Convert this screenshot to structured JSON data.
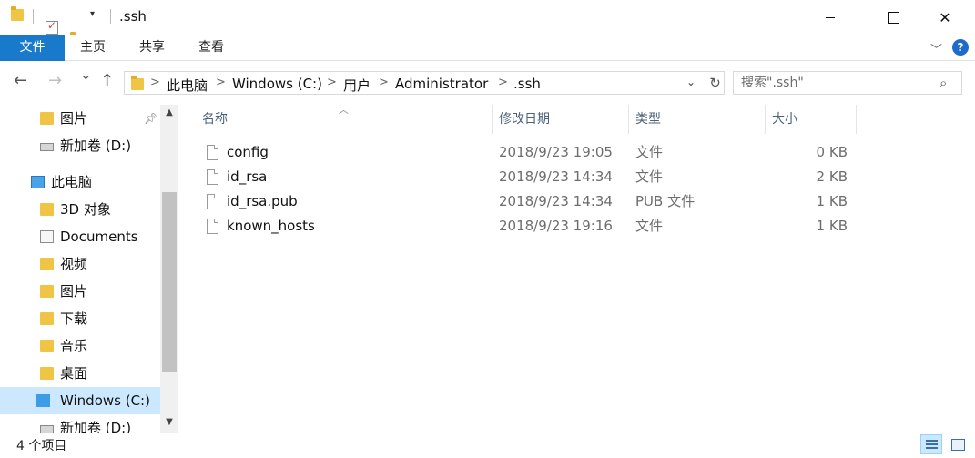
{
  "window": {
    "title": ".ssh",
    "quick_access_dropdown": "▾",
    "minimize": "—",
    "maximize": "☐",
    "close": "✕"
  },
  "ribbon": {
    "tabs": [
      "文件",
      "主页",
      "共享",
      "查看"
    ],
    "expand_icon": "chevron-down-icon",
    "help_label": "?"
  },
  "nav": {
    "back": "←",
    "forward": "→",
    "recent": "⌄",
    "up": "↑"
  },
  "address": {
    "crumbs": [
      "此电脑",
      "Windows (C:)",
      "用户",
      "Administrator",
      ".ssh"
    ],
    "separator": ">",
    "dropdown": "⌄",
    "refresh": "↻"
  },
  "search": {
    "placeholder": "搜索\".ssh\"",
    "icon": "search-icon"
  },
  "sidebar": {
    "items": [
      {
        "label": "图片",
        "icon": "folder-icon",
        "pinned": true
      },
      {
        "label": "新加卷 (D:)",
        "icon": "drive-icon"
      },
      {
        "label": "此电脑",
        "icon": "computer-icon"
      },
      {
        "label": "3D 对象",
        "icon": "folder-icon"
      },
      {
        "label": "Documents",
        "icon": "document-icon"
      },
      {
        "label": "视频",
        "icon": "folder-icon"
      },
      {
        "label": "图片",
        "icon": "folder-icon"
      },
      {
        "label": "下载",
        "icon": "folder-icon"
      },
      {
        "label": "音乐",
        "icon": "folder-icon"
      },
      {
        "label": "桌面",
        "icon": "folder-icon"
      },
      {
        "label": "Windows (C:)",
        "icon": "windows-drive-icon",
        "selected": true
      },
      {
        "label": "新加卷 (D:)",
        "icon": "drive-icon"
      }
    ],
    "scroll_up": "▲",
    "scroll_down": "▼"
  },
  "columns": {
    "name": "名称",
    "modified": "修改日期",
    "type": "类型",
    "size": "大小",
    "sort_indicator": "︿"
  },
  "files": [
    {
      "name": "config",
      "modified": "2018/9/23 19:05",
      "type": "文件",
      "size": "0 KB"
    },
    {
      "name": "id_rsa",
      "modified": "2018/9/23 14:34",
      "type": "文件",
      "size": "2 KB"
    },
    {
      "name": "id_rsa.pub",
      "modified": "2018/9/23 14:34",
      "type": "PUB 文件",
      "size": "1 KB"
    },
    {
      "name": "known_hosts",
      "modified": "2018/9/23 19:16",
      "type": "文件",
      "size": "1 KB"
    }
  ],
  "status": {
    "item_count": "4 个项目"
  },
  "colors": {
    "file_tab": "#1979ca",
    "selection": "#cce8ff",
    "header_text": "#4c607a"
  }
}
